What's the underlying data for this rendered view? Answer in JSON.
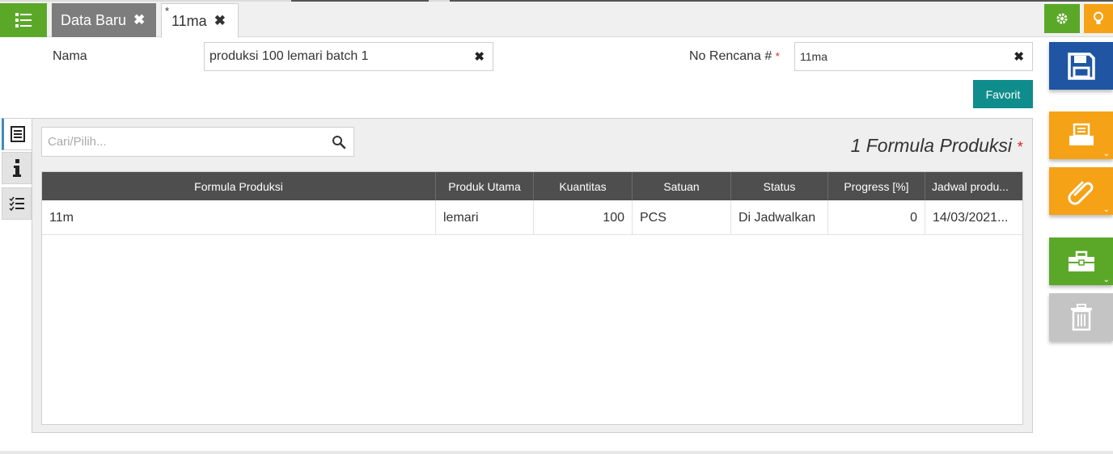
{
  "tabs": [
    {
      "label": "Data Baru",
      "active": false
    },
    {
      "label": "11ma",
      "active": true,
      "modified_marker": "*"
    }
  ],
  "tab_close_glyph": "✖",
  "form": {
    "nama_label": "Nama",
    "nama_value": "produksi 100 lemari batch 1",
    "no_rencana_label": "No Rencana #",
    "no_rencana_required": "*",
    "no_rencana_value": "11ma",
    "favorit_label": "Favorit"
  },
  "search": {
    "placeholder": "Cari/Pilih..."
  },
  "panel": {
    "title": "1 Formula Produksi",
    "required_marker": "*"
  },
  "table": {
    "columns": [
      "Formula Produksi",
      "Produk Utama",
      "Kuantitas",
      "Satuan",
      "Status",
      "Progress [%]",
      "Jadwal produ..."
    ],
    "rows": [
      [
        "11m",
        "lemari",
        "100",
        "PCS",
        "Di Jadwalkan",
        "0",
        "14/03/2021..."
      ]
    ]
  },
  "icons": {
    "menu": "list-menu-icon",
    "settings": "gear-icon",
    "tips": "lightbulb-icon",
    "save": "floppy-disk-icon",
    "print": "printer-icon",
    "attach": "paperclip-icon",
    "tools": "toolbox-icon",
    "delete": "trash-icon",
    "search": "magnifier-icon"
  },
  "colors": {
    "green": "#5ba829",
    "orange": "#f5a216",
    "blue": "#1f55a3",
    "teal": "#0f8c8c",
    "header_dark": "#4e4e4e",
    "required_red": "#e02020"
  }
}
